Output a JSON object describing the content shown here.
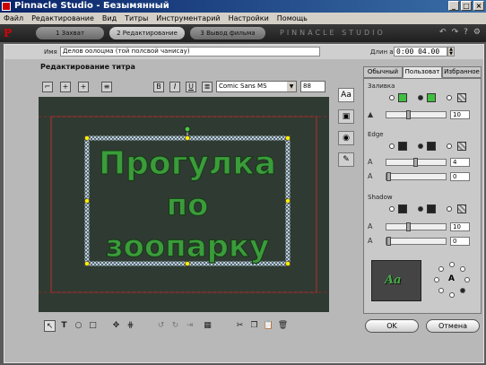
{
  "window": {
    "title": "Pinnacle Studio - Безымянный",
    "controls": [
      "_",
      "□",
      "×"
    ]
  },
  "menu": [
    "Файл",
    "Редактирование",
    "Вид",
    "Титры",
    "Инструментарий",
    "Настройки",
    "Помощь"
  ],
  "tabs": [
    {
      "label": "1 Захват",
      "active": false
    },
    {
      "label": "2 Редактирование",
      "active": true
    },
    {
      "label": "3 Вывод фильма",
      "active": false
    }
  ],
  "brand": "PINNACLE STUDIO",
  "title_editor": {
    "name_label": "Имя",
    "name_value": "Делов оолоцма (той полсвой чанисау)",
    "duration_label": "Длин а",
    "duration_value": "0:00 04.00",
    "heading": "Редактирование титра",
    "font": "Comic Sans MS",
    "size": "88",
    "title_lines": [
      "Прогулка",
      "по",
      "зоопарку"
    ],
    "prop_tabs": [
      {
        "label": "Обычный",
        "active": false
      },
      {
        "label": "Пользоват",
        "active": true
      },
      {
        "label": "Избранное",
        "active": false
      }
    ],
    "fill_label": "Заливка",
    "fill_value": "10",
    "edge_label": "Edge",
    "edge_values": [
      "4",
      "0"
    ],
    "shadow_label": "Shadow",
    "shadow_values": [
      "10",
      "0"
    ],
    "preview_text": "Aa",
    "ok_label": "OK",
    "cancel_label": "Отмена"
  },
  "colors": {
    "fill_green": "#3fbf3f",
    "canvas_bg": "#2f3b32",
    "text_fill": "#3a9c3a",
    "safe_area": "#b03030"
  },
  "icons": [
    "bold-icon",
    "italic-icon",
    "underline-icon",
    "align-icon",
    "select-arrow-icon",
    "text-tool-icon",
    "ellipse-tool-icon",
    "rect-tool-icon",
    "move-icon",
    "cut-icon",
    "copy-icon",
    "paste-icon",
    "delete-icon"
  ]
}
